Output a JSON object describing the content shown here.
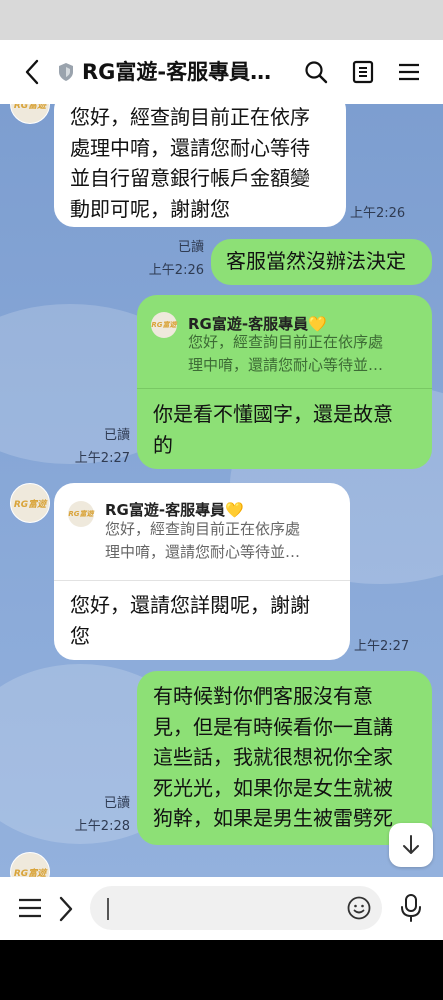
{
  "header": {
    "title": "RG富遊-客服專員…",
    "back_icon": "chevron-left-icon",
    "verified_icon": "shield-badge-icon",
    "search_icon": "search-icon",
    "notes_icon": "notes-icon",
    "menu_icon": "hamburger-menu-icon"
  },
  "contact": {
    "avatar_label": "RG富遊"
  },
  "messages": {
    "m1": {
      "text_lines": [
        "您好，經查詢目前正在依序",
        "處理中唷，還請您耐心等待",
        "並自行留意銀行帳戶金額變",
        "動即可呢，謝謝您"
      ],
      "time": "上午2:26"
    },
    "m2": {
      "text": "客服當然沒辦法決定",
      "read": "已讀",
      "time": "上午2:26"
    },
    "m3": {
      "quote_name": "RG富遊-客服專員💛",
      "quote_lines": [
        "您好，經查詢目前正在依序處",
        "理中唷，還請您耐心等待並…"
      ],
      "text_lines": [
        "你是看不懂國字，還是故意",
        "的"
      ],
      "read": "已讀",
      "time": "上午2:27"
    },
    "m4": {
      "quote_name": "RG富遊-客服專員💛",
      "quote_lines": [
        "您好，經查詢目前正在依序處",
        "理中唷，還請您耐心等待並…"
      ],
      "text_lines": [
        "您好，還請您詳閱呢，謝謝",
        "您"
      ],
      "time": "上午2:27"
    },
    "m5": {
      "text_lines": [
        "有時候對你們客服沒有意",
        "見，但是有時候看你一直講",
        "這些話，我就很想祝你全家",
        "死光光，如果你是女生就被",
        "狗幹，如果是男生被雷劈死"
      ],
      "read": "已讀",
      "time": "上午2:28"
    }
  },
  "input": {
    "placeholder": ""
  },
  "colors": {
    "chat_bg": "#86a6d6",
    "sent_bubble": "#8de076",
    "received_bubble": "#ffffff"
  }
}
